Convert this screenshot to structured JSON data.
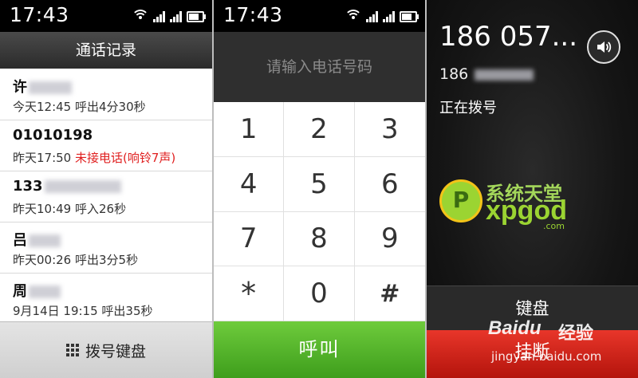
{
  "status": {
    "time": "17:43"
  },
  "call_log": {
    "title": "通话记录",
    "entries": [
      {
        "name": "许",
        "meta": "今天12:45  呼出4分30秒",
        "missed": ""
      },
      {
        "name": "01010198",
        "meta": "昨天17:50",
        "missed": "未接电话(响铃7声)"
      },
      {
        "name": "133",
        "meta": "昨天10:49  呼入26秒",
        "missed": ""
      },
      {
        "name": "吕",
        "meta": "昨天00:26  呼出3分5秒",
        "missed": ""
      },
      {
        "name": "周",
        "meta": "9月14日 19:15  呼出35秒",
        "missed": ""
      }
    ],
    "bottom_button": "拨号键盘"
  },
  "dialer": {
    "placeholder": "请输入电话号码",
    "keys": [
      "1",
      "2",
      "3",
      "4",
      "5",
      "6",
      "7",
      "8",
      "9",
      "*",
      "0",
      "#"
    ],
    "call_button": "呼叫"
  },
  "in_call": {
    "number_short": "186 057...",
    "number_prefix": "186",
    "status": "正在拨号",
    "keyboard_button": "键盘",
    "hangup_button": "挂断",
    "icons": {
      "speaker": "speaker-icon"
    }
  },
  "branding": {
    "logo_letter": "P",
    "logo_cn": "系统天堂",
    "logo_en": "xpgod",
    "logo_com": ".com",
    "watermark_baidu": "Baidu",
    "watermark_jingyan": "经验",
    "watermark_url": "jingyan.baidu.com"
  },
  "colors": {
    "call_green": "#4caf2a",
    "hangup_red": "#d62a1e",
    "missed_red": "#e02020"
  }
}
